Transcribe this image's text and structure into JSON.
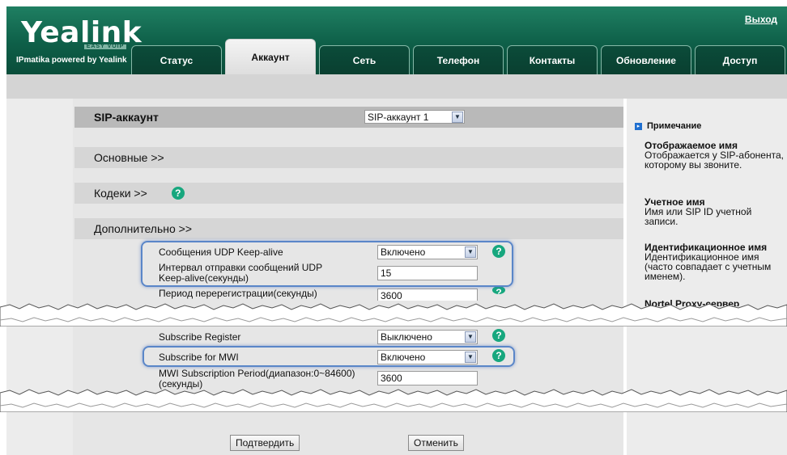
{
  "header": {
    "logo": "Yealink",
    "logo_sub": "EASY VOIP",
    "powered": "IPmatika powered by Yealink",
    "exit": "Выход",
    "tabs": [
      "Статус",
      "Аккаунт",
      "Сеть",
      "Телефон",
      "Контакты",
      "Обновление",
      "Доступ"
    ],
    "active_tab": "Аккаунт"
  },
  "sections": {
    "sip_account": "SIP-аккаунт",
    "sip_account_value": "SIP-аккаунт 1",
    "basic": "Основные >>",
    "codecs": "Кодеки >>",
    "advanced": "Дополнительно >>"
  },
  "rows": {
    "udp_keepalive_label": "Сообщения UDP Keep-alive",
    "udp_keepalive_value": "Включено",
    "udp_interval_label_1": "Интервал отправки сообщений UDP",
    "udp_interval_label_2": "Keep-alive(секунды)",
    "udp_interval_value": "15",
    "rereg_label": "Период перерегистрации(секунды)",
    "rereg_value": "3600",
    "subscribe_register_label": "Subscribe Register",
    "subscribe_register_value": "Выключено",
    "subscribe_mwi_label": "Subscribe for MWI",
    "subscribe_mwi_value": "Включено",
    "mwi_period_label_1": "MWI Subscription Period(диапазон:0~84600)",
    "mwi_period_label_2": "(секунды)",
    "mwi_period_value": "3600"
  },
  "buttons": {
    "confirm": "Подтвердить",
    "cancel": "Отменить"
  },
  "notes": {
    "title": "Примечание",
    "display_name_title": "Отображаемое имя",
    "display_name_text": "Отображается у SIP-абонента, которому вы звоните.",
    "account_name_title": "Учетное имя",
    "account_name_text": "Имя или SIP ID учетной записи.",
    "auth_name_title": "Идентификационное имя",
    "auth_name_text": "Идентификационное имя (часто совпадает с учетным именем).",
    "proxy_title": "Nortel Proxy-сервер"
  },
  "colors": {
    "header_green": "#0e5f48",
    "help_green": "#17a77e",
    "highlight_blue": "#5a86c8"
  }
}
